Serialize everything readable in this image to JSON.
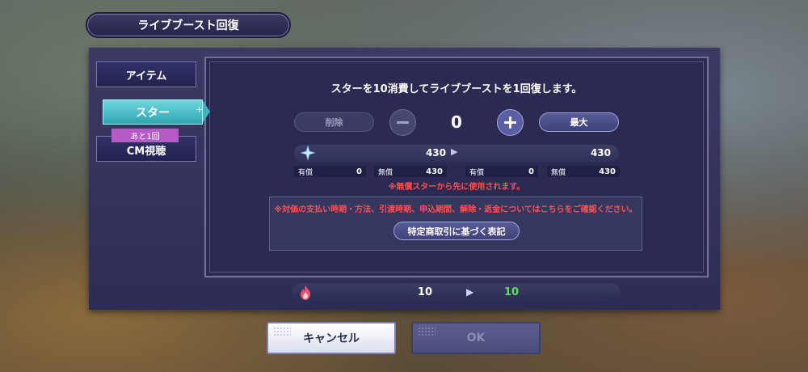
{
  "title": "ライブブースト回復",
  "tabs": {
    "item": "アイテム",
    "star": "スター",
    "star_plus": "+",
    "badge": "あと1回",
    "cm": "CM視聴"
  },
  "message": "スターを10消費してライブブーストを1回復します。",
  "controls": {
    "delete_label": "削除",
    "count": "0",
    "max_label": "最大"
  },
  "stars": {
    "before": "430",
    "arrow": "▶",
    "after": "430",
    "breakdown": [
      {
        "label": "有償",
        "value": "0"
      },
      {
        "label": "無償",
        "value": "430"
      },
      {
        "label": "有償",
        "value": "0"
      },
      {
        "label": "無償",
        "value": "430"
      }
    ]
  },
  "notice_free_first": "※無償スターから先に使用されます。",
  "legal": {
    "text": "※対価の支払い時期・方法、引渡時期、申込期間、解除・返金についてはこちらをご確認ください。",
    "button_label": "特定商取引に基づく表記"
  },
  "boost": {
    "before": "10",
    "arrow": "▶",
    "after": "10"
  },
  "buttons": {
    "cancel": "キャンセル",
    "ok": "OK"
  },
  "colors": {
    "accent_teal": "#3fb3c0",
    "badge_purple": "#b65ac7",
    "warning_red": "#ff4f4f",
    "boost_green": "#5ce35a"
  }
}
